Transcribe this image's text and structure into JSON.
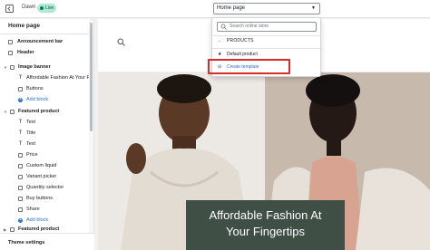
{
  "topbar": {
    "theme_name": "Dawn",
    "live_badge": "Live",
    "page_selector": "Home page"
  },
  "sidebar": {
    "title": "Home page",
    "items": [
      {
        "label": "Announcement bar",
        "kind": "section",
        "icon": "announcement-icon"
      },
      {
        "label": "Header",
        "kind": "section",
        "icon": "header-icon"
      },
      {
        "label": "Image banner",
        "kind": "section",
        "icon": "image-banner-icon"
      },
      {
        "label": "Affordable Fashion At Your Fi...",
        "kind": "block",
        "icon": "text-icon"
      },
      {
        "label": "Buttons",
        "kind": "block",
        "icon": "buttons-icon"
      },
      {
        "label": "Add block",
        "kind": "add"
      },
      {
        "label": "Featured product",
        "kind": "section",
        "icon": "product-icon"
      },
      {
        "label": "Text",
        "kind": "block",
        "icon": "text-icon"
      },
      {
        "label": "Title",
        "kind": "block",
        "icon": "title-icon"
      },
      {
        "label": "Text",
        "kind": "block",
        "icon": "text-icon"
      },
      {
        "label": "Price",
        "kind": "block",
        "icon": "price-icon"
      },
      {
        "label": "Custom liquid",
        "kind": "block",
        "icon": "liquid-icon"
      },
      {
        "label": "Variant picker",
        "kind": "block",
        "icon": "variant-icon"
      },
      {
        "label": "Quantity selector",
        "kind": "block",
        "icon": "quantity-icon"
      },
      {
        "label": "Buy buttons",
        "kind": "block",
        "icon": "buy-icon"
      },
      {
        "label": "Share",
        "kind": "block",
        "icon": "share-icon"
      },
      {
        "label": "Add block",
        "kind": "add"
      },
      {
        "label": "Featured product",
        "kind": "section",
        "icon": "product-icon"
      }
    ],
    "footer": "Theme settings"
  },
  "dropdown": {
    "search_placeholder": "Search online store",
    "back_label": "PRODUCTS",
    "default_item": "Default product",
    "create_item": "Create template"
  },
  "preview": {
    "banner_line1": "Affordable Fashion At",
    "banner_line2": "Your Fingertips"
  },
  "colors": {
    "accent": "#2c6ecb",
    "highlight": "#d82c2c",
    "live_badge": "#aee9d1",
    "banner_overlay": "#3f4f46"
  }
}
